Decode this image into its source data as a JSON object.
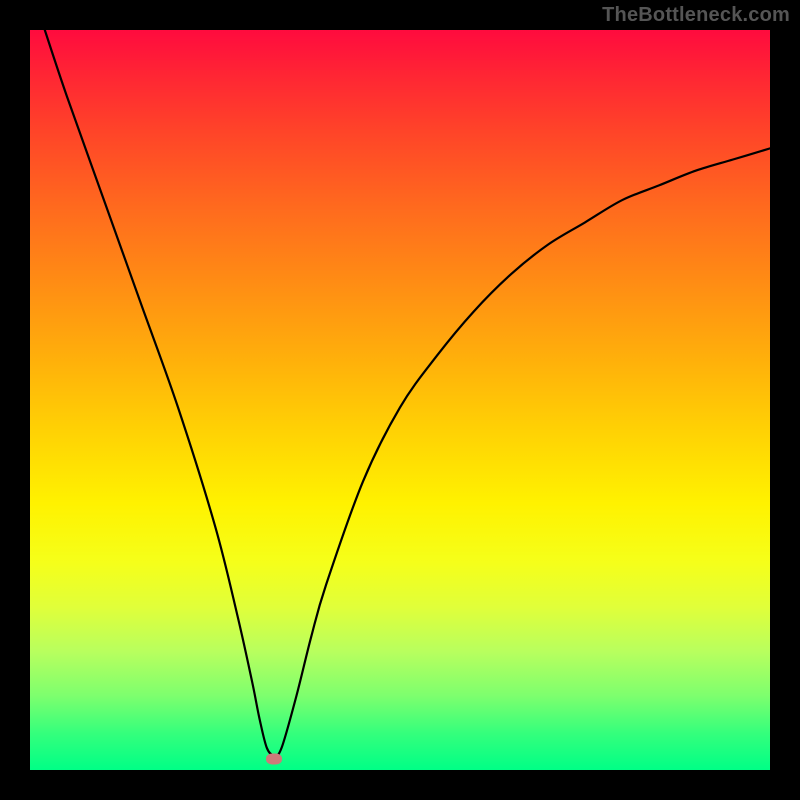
{
  "watermark": "TheBottleneck.com",
  "chart_data": {
    "type": "line",
    "title": "",
    "xlabel": "",
    "ylabel": "",
    "xlim": [
      0,
      100
    ],
    "ylim": [
      0,
      100
    ],
    "grid": false,
    "legend": false,
    "series": [
      {
        "name": "curve",
        "x": [
          2,
          5,
          10,
          15,
          20,
          25,
          28,
          30,
          31,
          32,
          33,
          34,
          36,
          38,
          40,
          45,
          50,
          55,
          60,
          65,
          70,
          75,
          80,
          85,
          90,
          95,
          100
        ],
        "y": [
          100,
          91,
          77,
          63,
          49,
          33,
          21,
          12,
          7,
          3,
          2,
          3,
          10,
          18,
          25,
          39,
          49,
          56,
          62,
          67,
          71,
          74,
          77,
          79,
          81,
          82.5,
          84
        ]
      }
    ],
    "marker": {
      "x": 33,
      "y": 1.5,
      "color": "#cc7a7a"
    },
    "background_gradient": {
      "direction": "vertical",
      "stops": [
        {
          "pos": 0,
          "color": "#ff0b3e"
        },
        {
          "pos": 24,
          "color": "#ff6a1e"
        },
        {
          "pos": 54,
          "color": "#ffd104"
        },
        {
          "pos": 72,
          "color": "#f5ff1a"
        },
        {
          "pos": 90,
          "color": "#7dff6e"
        },
        {
          "pos": 100,
          "color": "#00ff86"
        }
      ]
    }
  }
}
